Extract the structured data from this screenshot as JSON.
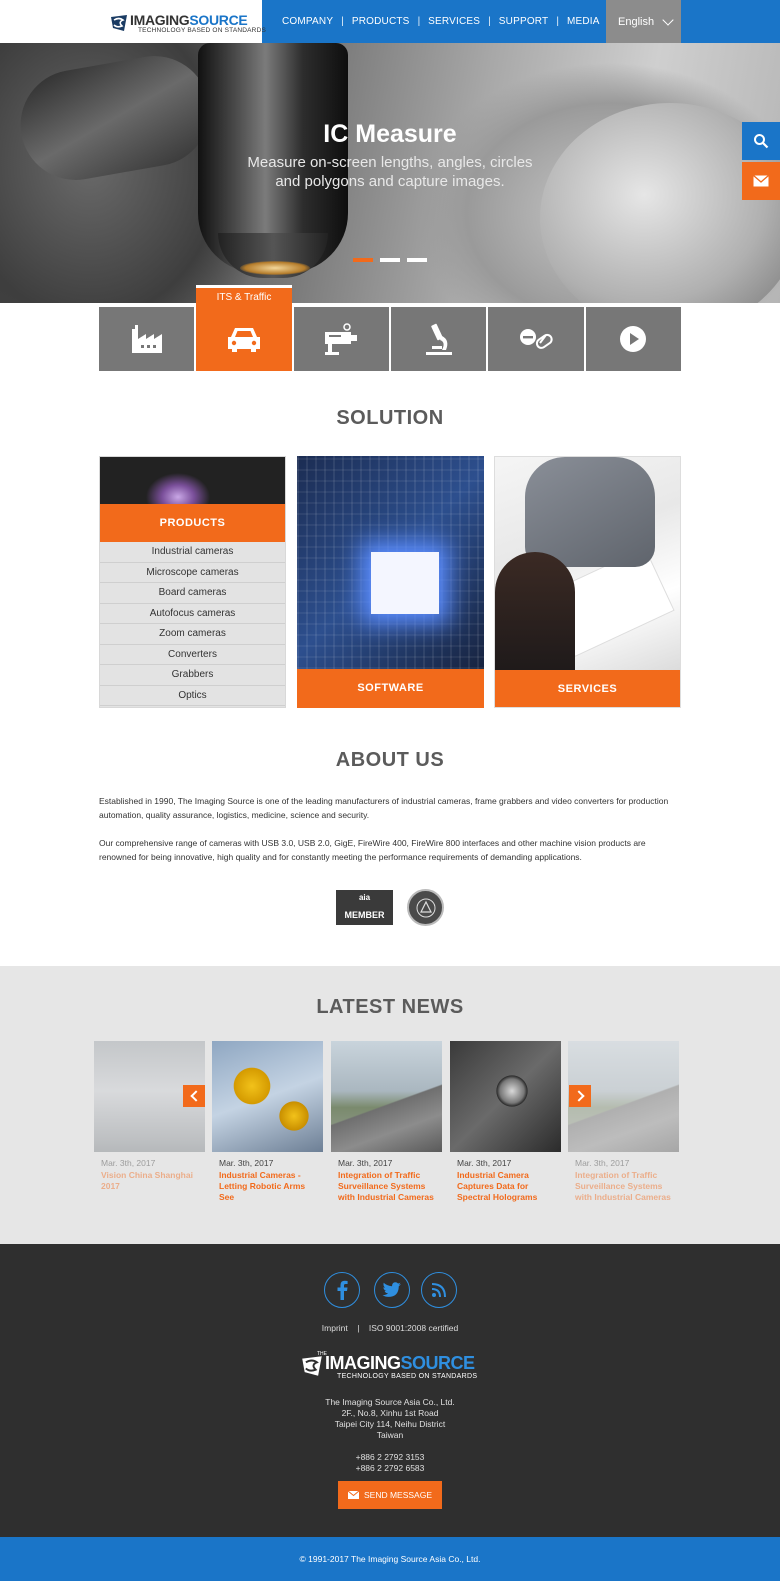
{
  "header": {
    "logo_brand": "IMAGINGSOURCE",
    "logo_tagline": "TECHNOLOGY BASED ON STANDARDS",
    "nav": [
      "COMPANY",
      "PRODUCTS",
      "SERVICES",
      "SUPPORT",
      "MEDIA"
    ],
    "language": "English"
  },
  "hero": {
    "title": "IC Measure",
    "subtitle_line1": "Measure on-screen lengths, angles, circles",
    "subtitle_line2": "and polygons and capture images.",
    "slides": 3,
    "active_slide": 0
  },
  "side_buttons": {
    "search": "search-icon",
    "mail": "mail-icon"
  },
  "categories": {
    "active_label": "ITS & Traffic",
    "items": [
      "factory-icon",
      "car-icon",
      "traffic-camera-icon",
      "microscope-icon",
      "pill-icon",
      "play-icon"
    ],
    "active_index": 1
  },
  "solution": {
    "heading": "SOLUTION",
    "products": {
      "title": "PRODUCTS",
      "items": [
        "Industrial cameras",
        "Microscope cameras",
        "Board cameras",
        "Autofocus cameras",
        "Zoom cameras",
        "Converters",
        "Grabbers",
        "Optics"
      ]
    },
    "software": "SOFTWARE",
    "services": "SERVICES"
  },
  "about": {
    "heading": "ABOUT US",
    "p1": "Established in 1990, The Imaging Source is one of the leading manufacturers of industrial cameras, frame grabbers and video converters for production automation, quality assurance, logistics, medicine, science and security.",
    "p2": "Our comprehensive range of cameras with USB 3.0, USB 2.0, GigE, FireWire 400, FireWire 800 interfaces and other machine vision products are renowned for being innovative, high quality and for constantly meeting the performance requirements of demanding applications.",
    "badge_aia_top": "aia",
    "badge_aia_member": "MEMBER"
  },
  "news": {
    "heading": "LATEST NEWS",
    "items": [
      {
        "date": "Mar. 3th, 2017",
        "title": "Vision China Shanghai 2017"
      },
      {
        "date": "Mar. 3th, 2017",
        "title": "Industrial Cameras - Letting Robotic Arms See"
      },
      {
        "date": "Mar. 3th, 2017",
        "title": "Integration of Traffic Surveillance Systems with Industrial Cameras"
      },
      {
        "date": "Mar. 3th, 2017",
        "title": "Industrial Camera Captures Data for Spectral Holograms"
      },
      {
        "date": "Mar. 3th, 2017",
        "title": "Integration of Traffic Surveillance Systems with Industrial Cameras"
      }
    ]
  },
  "footer": {
    "links": [
      "Imprint",
      "ISO 9001:2008 certified"
    ],
    "social": [
      "facebook-icon",
      "twitter-icon",
      "rss-icon"
    ],
    "logo_the": "THE",
    "logo_brand": "IMAGINGSOURCE",
    "logo_tagline": "TECHNOLOGY BASED ON STANDARDS",
    "address": [
      "The Imaging Source Asia Co., Ltd.",
      "2F., No.8, Xinhu 1st Road",
      "Taipei City 114, Neihu District",
      "Taiwan"
    ],
    "phones": [
      "+886 2 2792 3153",
      "+886 2 2792 6583"
    ],
    "send_message": "SEND MESSAGE",
    "copyright": "© 1991-2017 The Imaging Source Asia Co., Ltd."
  },
  "colors": {
    "blue": "#1a75c8",
    "orange": "#f26a1b",
    "gray": "#777777",
    "dark": "#2f2f2f"
  }
}
